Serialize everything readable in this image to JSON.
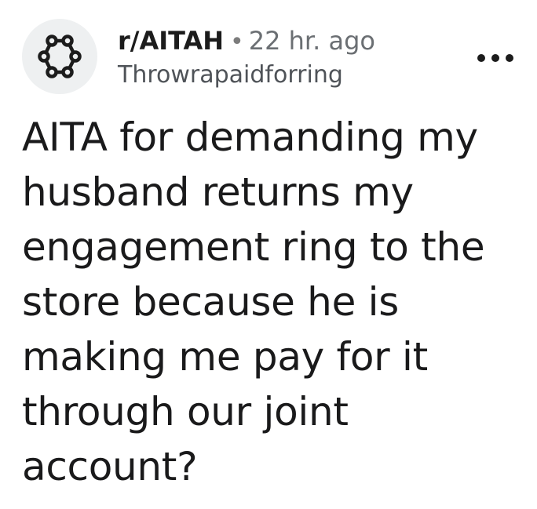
{
  "post": {
    "subreddit": "r/AITAH",
    "separator": "•",
    "time_ago": "22 hr. ago",
    "author": "Throwrapaidforring",
    "title": "AITA for demanding my husband returns my engagement ring to the store because he is making me pay for it through our joint account?"
  },
  "icons": {
    "avatar": "subreddit-avatar-icon",
    "more": "more-options-icon"
  },
  "colors": {
    "text_primary": "#1c1c1c",
    "text_secondary": "#6b6f73",
    "avatar_bg": "#eef0f1"
  }
}
